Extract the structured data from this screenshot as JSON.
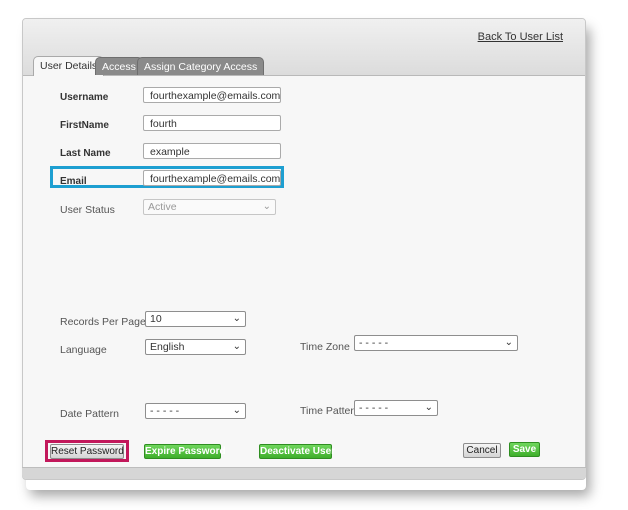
{
  "header": {
    "back_link": "Back To User List"
  },
  "tabs": [
    {
      "label": "User Details"
    },
    {
      "label": "Access"
    },
    {
      "label": "Assign Category Access"
    }
  ],
  "form": {
    "username_label": "Username",
    "username_value": "fourthexample@emails.com",
    "firstname_label": "FirstName",
    "firstname_value": "fourth",
    "lastname_label": "Last Name",
    "lastname_value": "example",
    "email_label": "Email",
    "email_value": "fourthexample@emails.com",
    "status_label": "User Status",
    "status_value": "Active",
    "records_label": "Records Per Page",
    "records_value": "10",
    "language_label": "Language",
    "language_value": "English",
    "timezone_label": "Time Zone",
    "timezone_value": "- - - - -",
    "datepattern_label": "Date Pattern",
    "datepattern_value": "- - - - -",
    "timepattern_label": "Time Pattern",
    "timepattern_value": "- - - - -"
  },
  "buttons": {
    "reset_password": "Reset Password",
    "expire_password": "Expire Password",
    "deactivate_user": "Deactivate User",
    "cancel": "Cancel",
    "save": "Save"
  },
  "colors": {
    "highlight_blue": "#1e9fd1",
    "highlight_red": "#c2185b",
    "green_button": "#3fae2b"
  }
}
